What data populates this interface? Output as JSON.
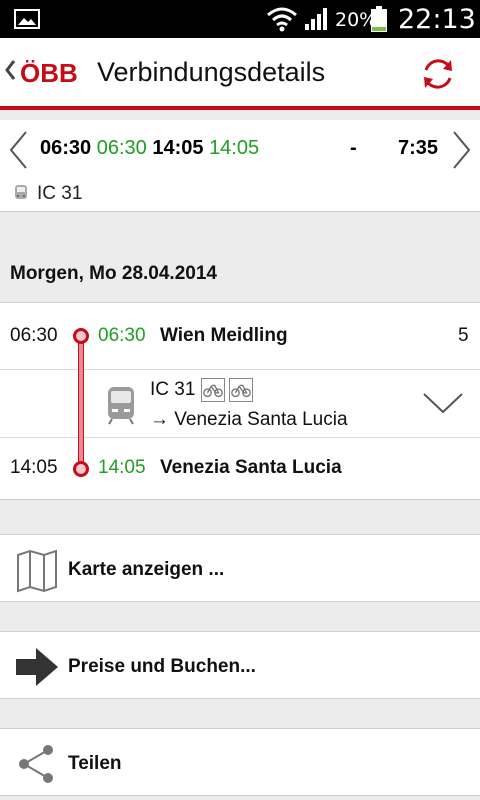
{
  "status_bar": {
    "battery_percent": "20%",
    "clock": "22:13"
  },
  "action_bar": {
    "logo_text": "ÖBB",
    "title": "Verbindungsdetails"
  },
  "summary": {
    "dep_planned": "06:30",
    "dep_real": "06:30",
    "arr_planned": "14:05",
    "arr_real": "14:05",
    "changes": "-",
    "duration": "7:35",
    "train": "IC 31"
  },
  "date_header": "Morgen, Mo 28.04.2014",
  "journey": {
    "departure": {
      "planned": "06:30",
      "real": "06:30",
      "station": "Wien Meidling",
      "platform": "5"
    },
    "train": {
      "name": "IC 31",
      "direction": "→ Venezia Santa Lucia"
    },
    "arrival": {
      "planned": "14:05",
      "real": "14:05",
      "station": "Venezia Santa Lucia"
    }
  },
  "actions": {
    "map": "Karte anzeigen ...",
    "prices": "Preise und Buchen...",
    "share": "Teilen"
  },
  "colors": {
    "brand_red": "#c70b17",
    "realtime_green": "#1fa01f"
  }
}
